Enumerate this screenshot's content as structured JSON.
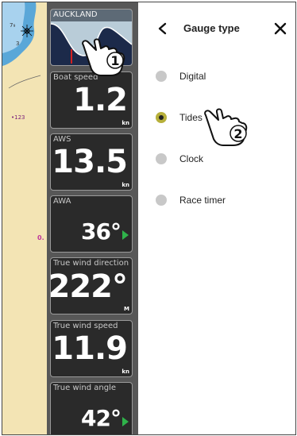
{
  "map": {
    "depth_top": "7₉",
    "depth_small": "3",
    "sounding": "•123",
    "marker": "0."
  },
  "gauges": [
    {
      "label": "AUCKLAND",
      "type": "tides"
    },
    {
      "label": "Boat speed",
      "value": "1.2",
      "unit": "kn"
    },
    {
      "label": "AWS",
      "value": "13.5",
      "unit": "kn"
    },
    {
      "label": "AWA",
      "value": "36°",
      "unit": ""
    },
    {
      "label": "True wind direction",
      "value": "222°",
      "unit": "M"
    },
    {
      "label": "True wind speed",
      "value": "11.9",
      "unit": "kn"
    },
    {
      "label": "True wind angle",
      "value": "42°",
      "unit": ""
    }
  ],
  "menu": {
    "title": "Gauge type",
    "options": [
      {
        "label": "Digital",
        "selected": false
      },
      {
        "label": "Tides",
        "selected": true
      },
      {
        "label": "Clock",
        "selected": false
      },
      {
        "label": "Race timer",
        "selected": false
      }
    ]
  },
  "steps": {
    "step1": "1",
    "step2": "2"
  },
  "colors": {
    "selected_radio": "#b7b03b",
    "direction_arrow": "#2fb34a",
    "map_land": "#f3e4b4",
    "map_water": "#5aa7d8"
  }
}
